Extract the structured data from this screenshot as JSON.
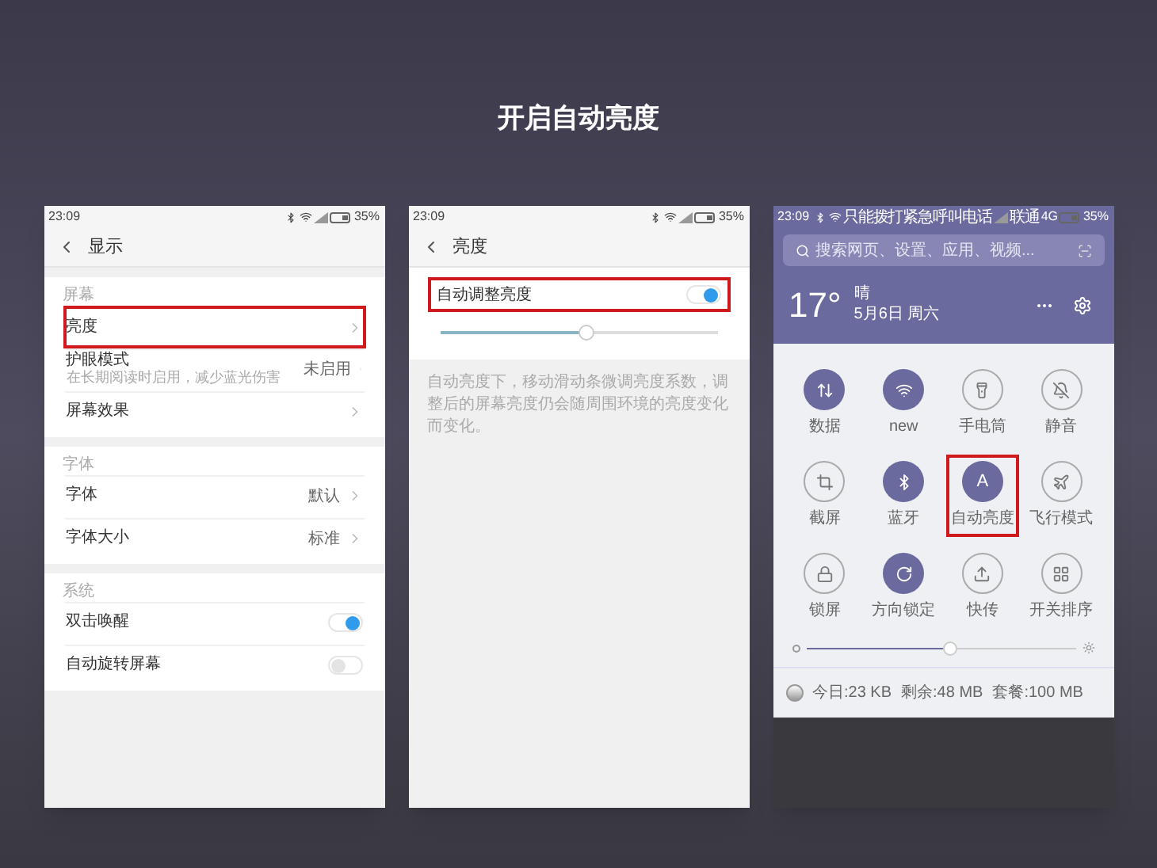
{
  "title": "开启自动亮度",
  "settings_screen": {
    "status": {
      "time": "23:09",
      "battery": "35%"
    },
    "title": "显示",
    "sections": [
      {
        "title": "屏幕",
        "items": [
          {
            "kind": "link",
            "label": "亮度",
            "highlighted": true
          },
          {
            "kind": "link",
            "label": "护眼模式",
            "subtitle": "在长期阅读时启用，减少蓝光伤害",
            "value": "未启用",
            "highlighted": false
          },
          {
            "kind": "link",
            "label": "屏幕效果",
            "highlighted": false
          }
        ]
      },
      {
        "title": "字体",
        "items": [
          {
            "kind": "link",
            "label": "字体",
            "value": "默认",
            "highlighted": false
          },
          {
            "kind": "link",
            "label": "字体大小",
            "value": "标准",
            "highlighted": false
          }
        ]
      },
      {
        "title": "系统",
        "items": [
          {
            "kind": "toggle",
            "label": "双击唤醒",
            "on": true,
            "highlighted": false
          },
          {
            "kind": "toggle",
            "label": "自动旋转屏幕",
            "on": false,
            "highlighted": false
          }
        ]
      }
    ]
  },
  "brightness_screen": {
    "status": {
      "time": "23:09",
      "battery": "35%"
    },
    "title": "亮度",
    "auto_toggle": {
      "label": "自动调整亮度",
      "on": true,
      "highlighted": true
    },
    "slider": {
      "level": 0.53
    },
    "note": "自动亮度下，移动滑动条微调亮度系数，调整后的屏幕亮度仍会随周围环境的亮度变化而变化。"
  },
  "control_center": {
    "status": {
      "time": "23:09",
      "notice": "只能拨打紧急呼叫电话",
      "carrier": "联通",
      "network": "4G",
      "battery": "35%"
    },
    "search": {
      "placeholder": "搜索网页、设置、应用、视频..."
    },
    "weather": {
      "temperature": "17°",
      "condition": "晴",
      "date": "5月6日 周六"
    },
    "tiles": [
      {
        "label": "数据",
        "on": true,
        "highlighted": false
      },
      {
        "label": "new",
        "on": true,
        "highlighted": false
      },
      {
        "label": "手电筒",
        "on": false,
        "highlighted": false
      },
      {
        "label": "静音",
        "on": false,
        "highlighted": false
      },
      {
        "label": "截屏",
        "on": false,
        "highlighted": false
      },
      {
        "label": "蓝牙",
        "on": true,
        "highlighted": false
      },
      {
        "label": "自动亮度",
        "glyph": "A",
        "on": true,
        "highlighted": true
      },
      {
        "label": "飞行模式",
        "on": false,
        "highlighted": false
      },
      {
        "label": "锁屏",
        "on": false,
        "highlighted": false
      },
      {
        "label": "方向锁定",
        "on": true,
        "highlighted": false
      },
      {
        "label": "快传",
        "on": false,
        "highlighted": false
      },
      {
        "label": "开关排序",
        "on": false,
        "highlighted": false
      }
    ],
    "brightness": {
      "level": 0.53
    },
    "data_usage": {
      "today": "今日:23 KB",
      "remaining": "剩余:48 MB",
      "plan": "套餐:100 MB"
    }
  }
}
